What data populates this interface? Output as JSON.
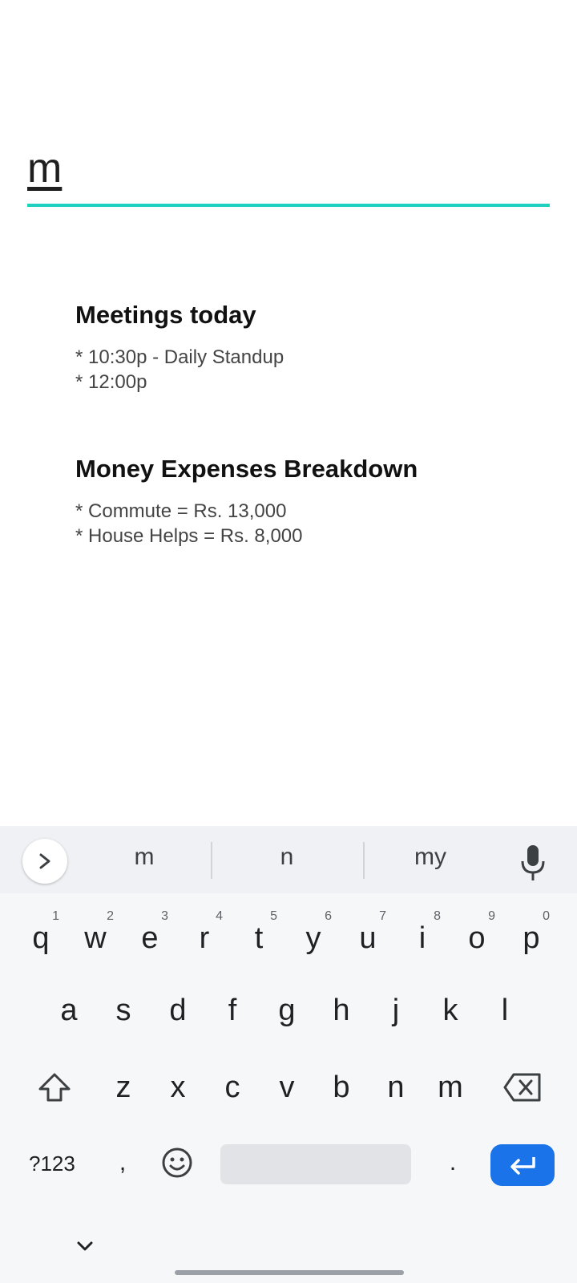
{
  "search": {
    "value": "m"
  },
  "results": [
    {
      "title": "Meetings today",
      "lines": [
        "* 10:30p - Daily Standup",
        "* 12:00p"
      ]
    },
    {
      "title": "Money Expenses Breakdown",
      "lines": [
        "* Commute = Rs. 13,000",
        "* House Helps = Rs. 8,000"
      ]
    }
  ],
  "keyboard": {
    "suggestions": [
      "m",
      "n",
      "my"
    ],
    "row1": [
      {
        "k": "q",
        "h": "1"
      },
      {
        "k": "w",
        "h": "2"
      },
      {
        "k": "e",
        "h": "3"
      },
      {
        "k": "r",
        "h": "4"
      },
      {
        "k": "t",
        "h": "5"
      },
      {
        "k": "y",
        "h": "6"
      },
      {
        "k": "u",
        "h": "7"
      },
      {
        "k": "i",
        "h": "8"
      },
      {
        "k": "o",
        "h": "9"
      },
      {
        "k": "p",
        "h": "0"
      }
    ],
    "row2": [
      "a",
      "s",
      "d",
      "f",
      "g",
      "h",
      "j",
      "k",
      "l"
    ],
    "row3": [
      "z",
      "x",
      "c",
      "v",
      "b",
      "n",
      "m"
    ],
    "symbols_label": "?123",
    "comma": ",",
    "period": "."
  }
}
